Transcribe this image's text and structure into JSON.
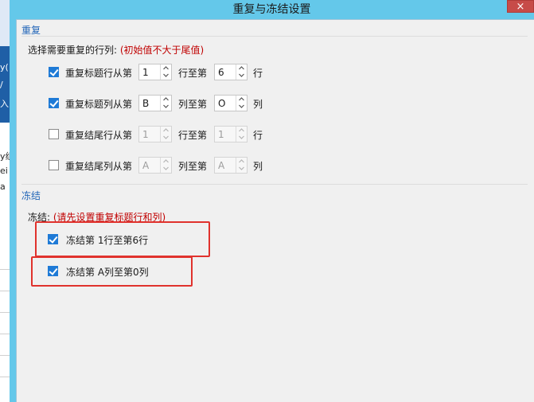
{
  "background_app": {
    "fragments": [
      "y(",
      "(",
      "/",
      "入",
      "y组",
      "ei",
      "a"
    ]
  },
  "dialog": {
    "title": "重复与冻结设置",
    "close_label": "×"
  },
  "repeat": {
    "section_title": "重复",
    "prompt": "选择需要重复的行列:",
    "hint": "(初始值不大于尾值)",
    "rows": [
      {
        "checked": true,
        "label": "重复标题行从第",
        "from": "1",
        "middle": "行至第",
        "to": "6",
        "unit": "行",
        "enabled": true
      },
      {
        "checked": true,
        "label": "重复标题列从第",
        "from": "B",
        "middle": "列至第",
        "to": "O",
        "unit": "列",
        "enabled": true
      },
      {
        "checked": false,
        "label": "重复结尾行从第",
        "from": "1",
        "middle": "行至第",
        "to": "1",
        "unit": "行",
        "enabled": false
      },
      {
        "checked": false,
        "label": "重复结尾列从第",
        "from": "A",
        "middle": "列至第",
        "to": "A",
        "unit": "列",
        "enabled": false
      }
    ]
  },
  "freeze": {
    "section_title": "冻结",
    "prompt": "冻结:",
    "hint": "(请先设置重复标题行和列)",
    "rows": [
      {
        "checked": true,
        "label": "冻结第 1行至第6行"
      },
      {
        "checked": true,
        "label": "冻结第 A列至第0列"
      }
    ]
  },
  "colors": {
    "title_bar": "#64c8ea",
    "close_button": "#c74b48",
    "section_title": "#2366b8",
    "hint_text": "#c00000",
    "checkbox_checked": "#1e7ad6",
    "highlight_box": "#e0322d"
  }
}
